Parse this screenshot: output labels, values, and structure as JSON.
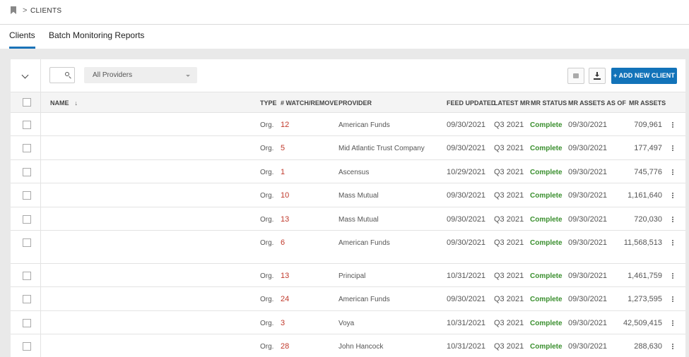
{
  "breadcrumb": {
    "separator": ">",
    "current": "CLIENTS"
  },
  "tabs": [
    {
      "label": "Clients",
      "active": true
    },
    {
      "label": "Batch Monitoring Reports",
      "active": false
    }
  ],
  "toolbar": {
    "provider_filter": "All Providers",
    "add_button": "+ ADD NEW CLIENT"
  },
  "table": {
    "columns": {
      "name": "NAME",
      "type": "TYPE",
      "watch": "# WATCH/REMOVE",
      "provider": "PROVIDER",
      "feed_updated": "FEED UPDATED",
      "latest_mr": "LATEST MR",
      "mr_status": "MR STATUS",
      "mr_assets_as_of": "MR ASSETS AS OF",
      "mr_assets": "MR ASSETS"
    },
    "sort_indicator": "↓",
    "rows": [
      {
        "type": "Org.",
        "watch": "12",
        "provider": "American Funds",
        "feed_updated": "09/30/2021",
        "latest_mr": "Q3 2021",
        "status": "Complete",
        "as_of": "09/30/2021",
        "assets": "709,961"
      },
      {
        "type": "Org.",
        "watch": "5",
        "provider": "Mid Atlantic Trust Company",
        "feed_updated": "09/30/2021",
        "latest_mr": "Q3 2021",
        "status": "Complete",
        "as_of": "09/30/2021",
        "assets": "177,497"
      },
      {
        "type": "Org.",
        "watch": "1",
        "provider": "Ascensus",
        "feed_updated": "10/29/2021",
        "latest_mr": "Q3 2021",
        "status": "Complete",
        "as_of": "09/30/2021",
        "assets": "745,776"
      },
      {
        "type": "Org.",
        "watch": "10",
        "provider": "Mass Mutual",
        "feed_updated": "09/30/2021",
        "latest_mr": "Q3 2021",
        "status": "Complete",
        "as_of": "09/30/2021",
        "assets": "1,161,640"
      },
      {
        "type": "Org.",
        "watch": "13",
        "provider": "Mass Mutual",
        "feed_updated": "09/30/2021",
        "latest_mr": "Q3 2021",
        "status": "Complete",
        "as_of": "09/30/2021",
        "assets": "720,030"
      },
      {
        "type": "Org.",
        "watch": "6",
        "provider": "American Funds",
        "feed_updated": "09/30/2021",
        "latest_mr": "Q3 2021",
        "status": "Complete",
        "as_of": "09/30/2021",
        "assets": "11,568,513"
      },
      {
        "type": "Org.",
        "watch": "13",
        "provider": "Principal",
        "feed_updated": "10/31/2021",
        "latest_mr": "Q3 2021",
        "status": "Complete",
        "as_of": "09/30/2021",
        "assets": "1,461,759"
      },
      {
        "type": "Org.",
        "watch": "24",
        "provider": "American Funds",
        "feed_updated": "09/30/2021",
        "latest_mr": "Q3 2021",
        "status": "Complete",
        "as_of": "09/30/2021",
        "assets": "1,273,595"
      },
      {
        "type": "Org.",
        "watch": "3",
        "provider": "Voya",
        "feed_updated": "10/31/2021",
        "latest_mr": "Q3 2021",
        "status": "Complete",
        "as_of": "09/30/2021",
        "assets": "42,509,415"
      },
      {
        "type": "Org.",
        "watch": "28",
        "provider": "John Hancock",
        "feed_updated": "10/31/2021",
        "latest_mr": "Q3 2021",
        "status": "Complete",
        "as_of": "09/30/2021",
        "assets": "288,630"
      }
    ]
  },
  "colors": {
    "accent": "#1273b9",
    "watch": "#c0392b",
    "status_complete": "#3a8f2e"
  }
}
